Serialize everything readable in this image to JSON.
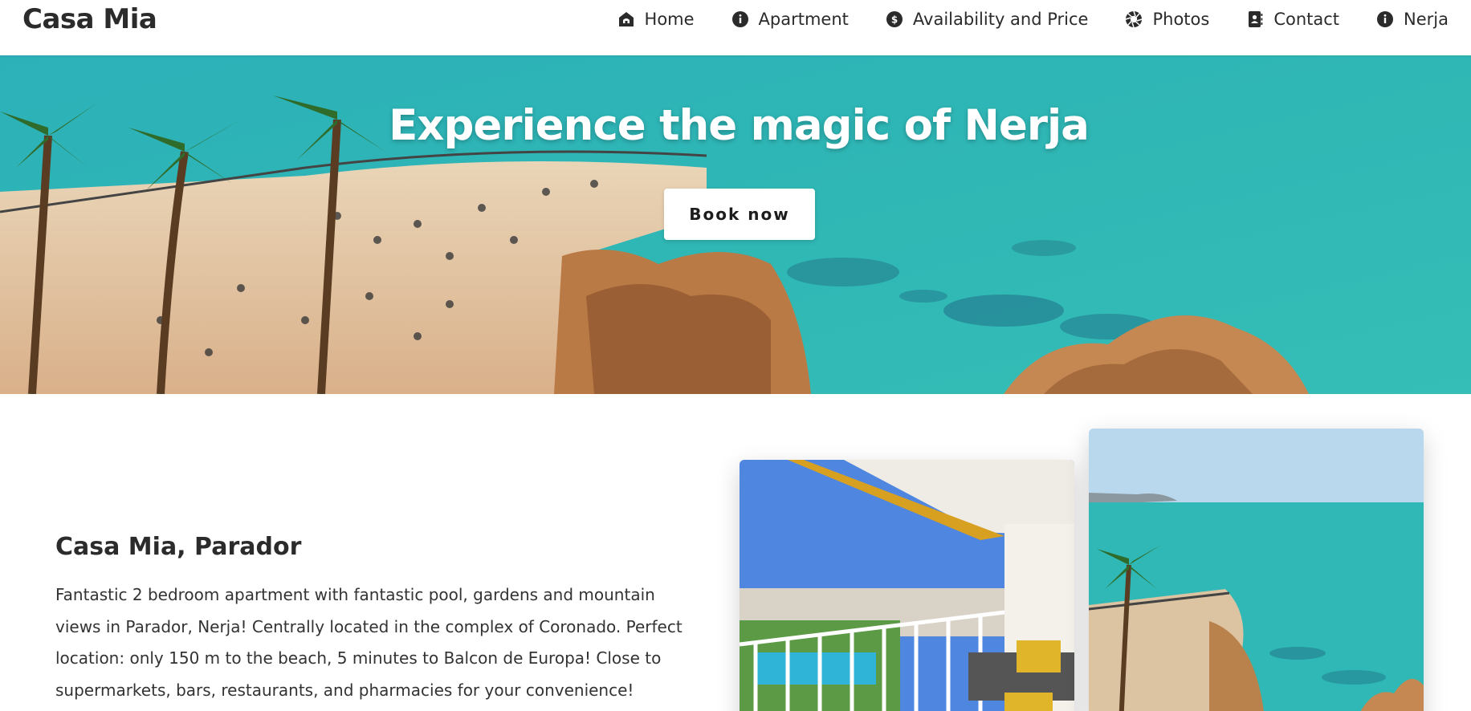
{
  "header": {
    "brand": "Casa Mia",
    "nav": [
      {
        "label": "Home",
        "icon": "home-icon"
      },
      {
        "label": "Apartment",
        "icon": "info-icon"
      },
      {
        "label": "Availability and Price",
        "icon": "dollar-icon"
      },
      {
        "label": "Photos",
        "icon": "aperture-icon"
      },
      {
        "label": "Contact",
        "icon": "contact-book-icon"
      },
      {
        "label": "Nerja",
        "icon": "info-icon"
      }
    ]
  },
  "hero": {
    "title": "Experience the magic of Nerja",
    "button_label": "Book now"
  },
  "about": {
    "title": "Casa Mia, Parador",
    "text": "Fantastic 2 bedroom apartment with fantastic pool, gardens and mountain views in Parador, Nerja! Centrally located in the complex of Coronado. Perfect location: only 150 m to the beach, 5 minutes to Balcon de Europa! Close to supermarkets, bars, restaurants, and pharmacies for your convenience!"
  },
  "colors": {
    "text": "#2b2b2b",
    "sea": "#2fb7b5",
    "button_bg": "#ffffff"
  }
}
